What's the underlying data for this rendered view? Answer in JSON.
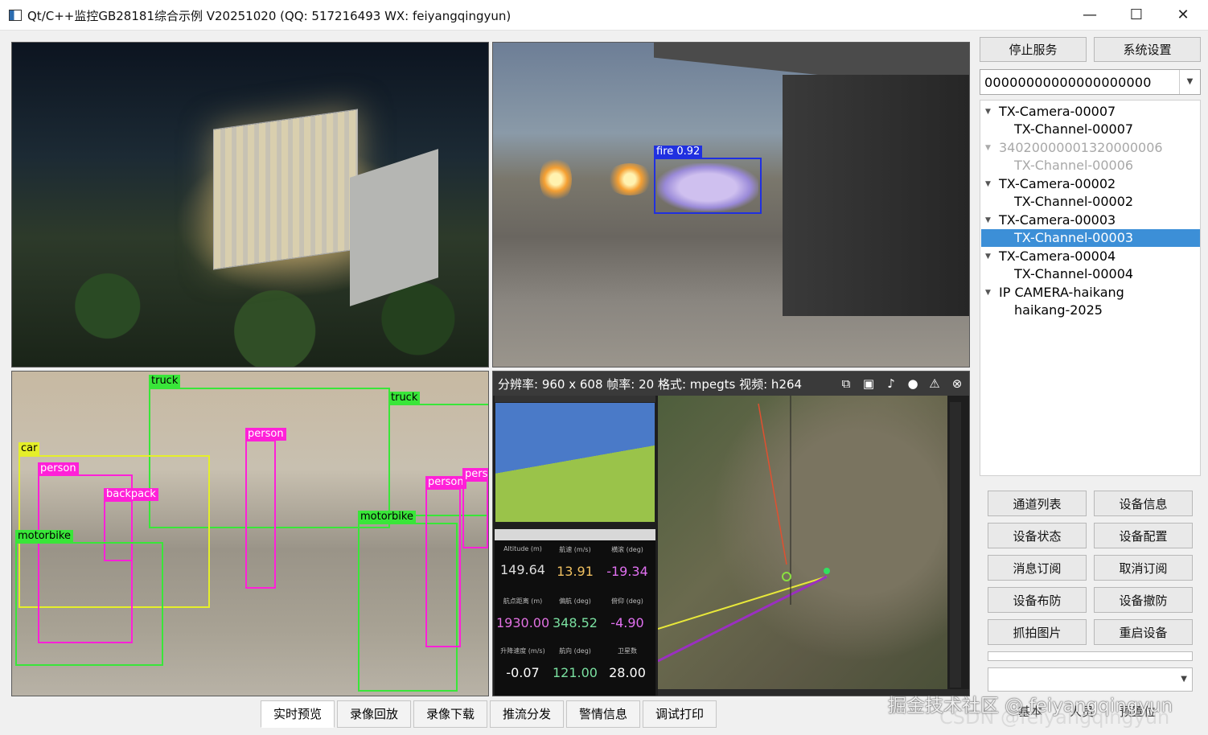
{
  "window": {
    "title": "Qt/C++监控GB28181综合示例 V20251020 (QQ: 517216493 WX: feiyangqingyun)",
    "minimize_glyph": "—",
    "maximize_glyph": "☐",
    "close_glyph": "✕"
  },
  "video": {
    "fire_label": "fire 0.92",
    "detections": {
      "truck_1": "truck",
      "truck_2": "truck",
      "car": "car",
      "person_1": "person",
      "person_2": "person",
      "person_3": "person",
      "person_4": "perso",
      "backpack": "backpack",
      "motorbike_1": "motorbike",
      "motorbike_2": "motorbike"
    },
    "status_text": "分辨率: 960 x 608  帧率: 20  格式: mpegts  视频: h264",
    "telemetry": {
      "r1_labels": [
        "Altitude (m)",
        "航速 (m/s)",
        "横滚 (deg)"
      ],
      "r1_values": [
        "149.64",
        "13.91",
        "-19.34"
      ],
      "r2_labels": [
        "航点距离 (m)",
        "偏航 (deg)",
        "俯仰 (deg)"
      ],
      "r2_values": [
        "1930.00",
        "348.52",
        "-4.90"
      ],
      "r3_labels": [
        "升降速度 (m/s)",
        "航向 (deg)",
        "卫星数"
      ],
      "r3_values": [
        "-0.07",
        "121.00",
        "28.00"
      ]
    }
  },
  "sidebar": {
    "stop_service": "停止服务",
    "system_settings": "系统设置",
    "device_id": "00000000000000000000",
    "tree": [
      {
        "label": "TX-Camera-00007",
        "level": 0,
        "state": "normal"
      },
      {
        "label": "TX-Channel-00007",
        "level": 1,
        "state": "normal"
      },
      {
        "label": "34020000001320000006",
        "level": 0,
        "state": "dim"
      },
      {
        "label": "TX-Channel-00006",
        "level": 1,
        "state": "dim"
      },
      {
        "label": "TX-Camera-00002",
        "level": 0,
        "state": "normal"
      },
      {
        "label": "TX-Channel-00002",
        "level": 1,
        "state": "normal"
      },
      {
        "label": "TX-Camera-00003",
        "level": 0,
        "state": "normal"
      },
      {
        "label": "TX-Channel-00003",
        "level": 1,
        "state": "selected"
      },
      {
        "label": "TX-Camera-00004",
        "level": 0,
        "state": "normal"
      },
      {
        "label": "TX-Channel-00004",
        "level": 1,
        "state": "normal"
      },
      {
        "label": "IP CAMERA-haikang",
        "level": 0,
        "state": "normal"
      },
      {
        "label": "haikang-2025",
        "level": 1,
        "state": "normal"
      }
    ],
    "actions": [
      "通道列表",
      "设备信息",
      "设备状态",
      "设备配置",
      "消息订阅",
      "取消订阅",
      "设备布防",
      "设备撤防",
      "抓拍图片",
      "重启设备"
    ]
  },
  "tabs": [
    "实时预览",
    "录像回放",
    "录像下载",
    "推流分发",
    "警情信息",
    "调试打印"
  ],
  "right_tabs": [
    "基本",
    "人员",
    "预置位"
  ],
  "watermark": "掘金技术社区 @ feiyangqingyun",
  "watermark2": "CSDN @feiyangqingyun",
  "colors": {
    "selection": "#3c8fd7",
    "fire_box": "#2030e0",
    "det_green": "#39e639",
    "det_yellow": "#e5ef2a",
    "det_magenta": "#ff20d8"
  },
  "icons": [
    "snapshot-icon",
    "image-icon",
    "mute-icon",
    "mic-icon",
    "alarm-icon",
    "close-circle-icon"
  ]
}
